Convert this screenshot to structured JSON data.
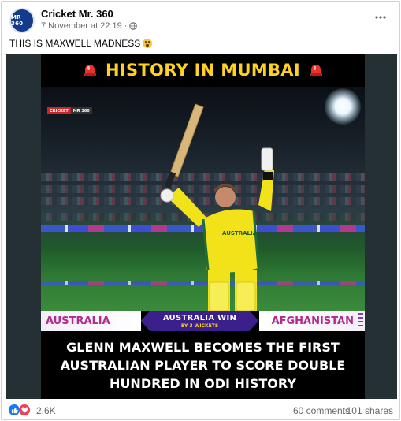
{
  "post": {
    "page_name": "Cricket Mr. 360",
    "timestamp": "7 November at 22:19",
    "separator": "·",
    "avatar_text": "MR 360",
    "caption": "THIS IS MAXWELL MADNESS",
    "caption_emoji": "scream-emoji"
  },
  "media": {
    "top_headline": "HISTORY IN MUMBAI",
    "watermark_left": "CRICKET",
    "watermark_right": "MR 360",
    "team_left": "AUSTRALIA",
    "result_main": "AUSTRALIA WIN",
    "result_sub": "BY 3 WICKETS",
    "team_right": "AFGHANISTAN",
    "bottom_headline": "GLENN MAXWELL BECOMES THE FIRST\nAUSTRALIAN PLAYER TO SCORE DOUBLE\nHUNDRED IN ODI HISTORY",
    "jersey_text": "AUSTRALIA"
  },
  "footer": {
    "reaction_count": "2.6K",
    "comments": "60 comments",
    "shares": "101 shares"
  },
  "icons": [
    "globe-icon",
    "more-options-icon",
    "siren-icon",
    "like-reaction-icon",
    "love-reaction-icon"
  ],
  "colors": {
    "headline_yellow": "#ffd21f",
    "team_magenta": "#b42a8c",
    "result_purple": "#3b1f8a",
    "jersey_yellow": "#f2e21a",
    "facebook_blue": "#1877f2",
    "love_red": "#f33e58",
    "muted_text": "#65676b"
  }
}
